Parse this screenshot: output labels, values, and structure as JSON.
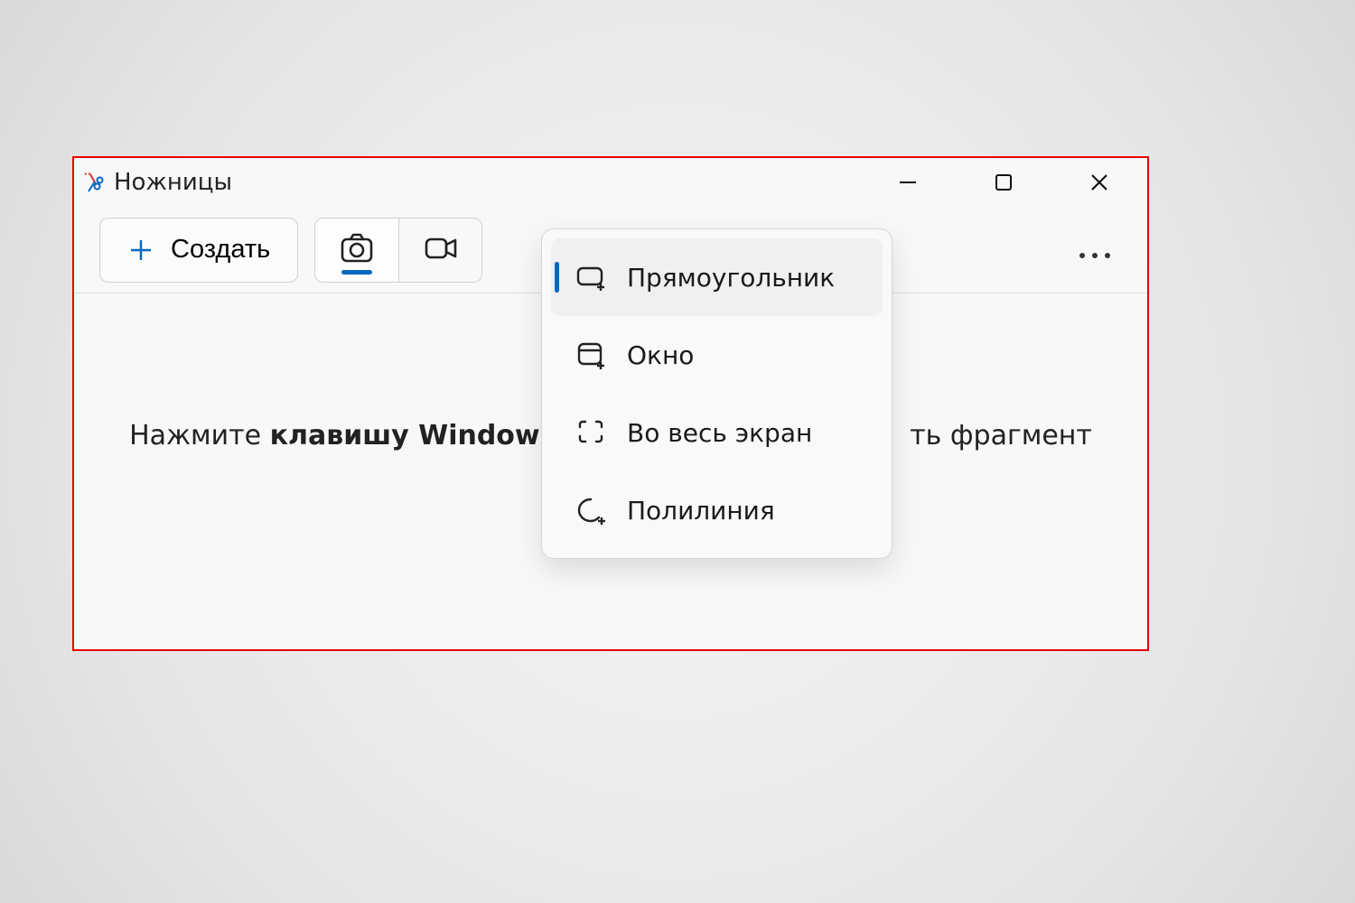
{
  "app": {
    "title": "Ножницы"
  },
  "toolbar": {
    "create_label": "Создать"
  },
  "menu": {
    "items": [
      {
        "label": "Прямоугольник"
      },
      {
        "label": "Окно"
      },
      {
        "label": "Во весь экран"
      },
      {
        "label": "Полилиния"
      }
    ]
  },
  "hint": {
    "prefix": "Нажмите ",
    "bold": "клавишу Window",
    "suffix_visible": "ть фрагмент"
  }
}
